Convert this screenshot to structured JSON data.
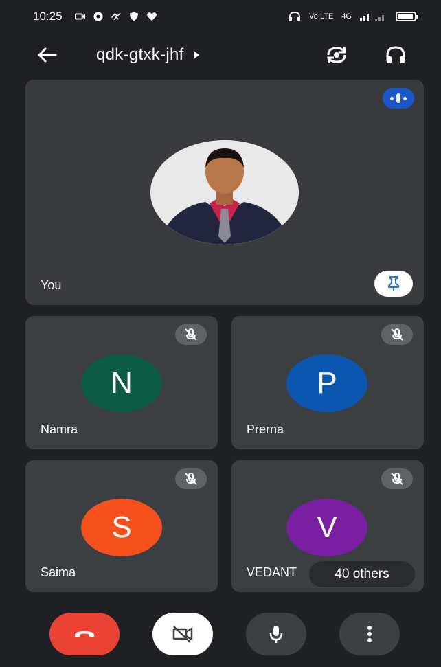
{
  "status_bar": {
    "time": "10:25",
    "network_label": "Vo LTE",
    "signal_label": "4G",
    "icons": [
      "camera-status-icon",
      "jio-icon",
      "share-icon",
      "shield-icon",
      "heart-icon",
      "headset-status-icon",
      "signal-icon",
      "battery-icon"
    ],
    "battery_level": 0.9
  },
  "top_bar": {
    "meeting_code": "qdk-gtxk-jhf",
    "icons": [
      "back-arrow-icon",
      "caret-right-icon",
      "switch-camera-icon",
      "headphones-icon"
    ]
  },
  "self_tile": {
    "name": "You",
    "icons": [
      "speaking-indicator-icon",
      "pin-icon"
    ]
  },
  "participants": [
    {
      "initial": "N",
      "name": "Namra",
      "color": "#0d5c45",
      "muted": true
    },
    {
      "initial": "P",
      "name": "Prerna",
      "color": "#0b57b0",
      "muted": true
    },
    {
      "initial": "S",
      "name": "Saima",
      "color": "#f4511e",
      "muted": true
    },
    {
      "initial": "V",
      "name": "VEDANT",
      "color": "#7b1fa2",
      "muted": true
    }
  ],
  "others_pill": {
    "label": "40 others"
  },
  "controls": {
    "icons": [
      "hang-up-icon",
      "camera-off-icon",
      "microphone-icon",
      "more-vert-icon"
    ],
    "colors": {
      "hangup": "#ea4335",
      "camera": "#ffffff",
      "mic": "#3c4043",
      "more": "#3c4043"
    }
  },
  "colors": {
    "background": "#202124",
    "tile": "#3c4043",
    "accent": "#1a73e8"
  }
}
